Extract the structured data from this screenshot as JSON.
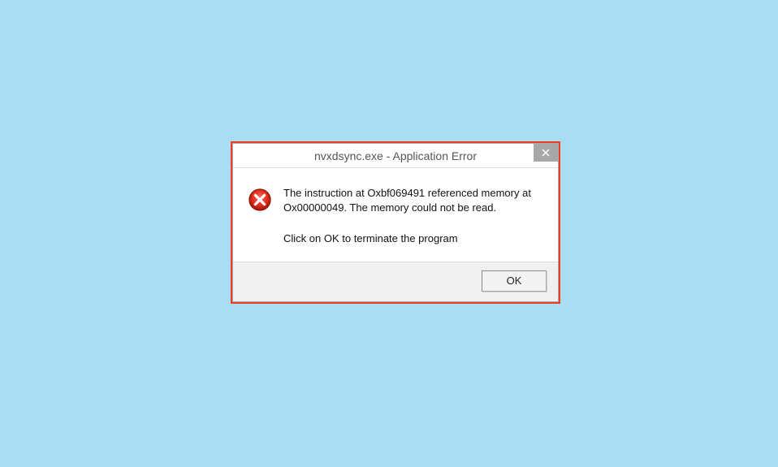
{
  "dialog": {
    "title": "nvxdsync.exe - Application Error",
    "message_line1": "The instruction at Oxbf069491 referenced memory at Ox00000049. The memory could not be read.",
    "message_line2": "Click on OK to terminate the program",
    "ok_label": "OK"
  }
}
